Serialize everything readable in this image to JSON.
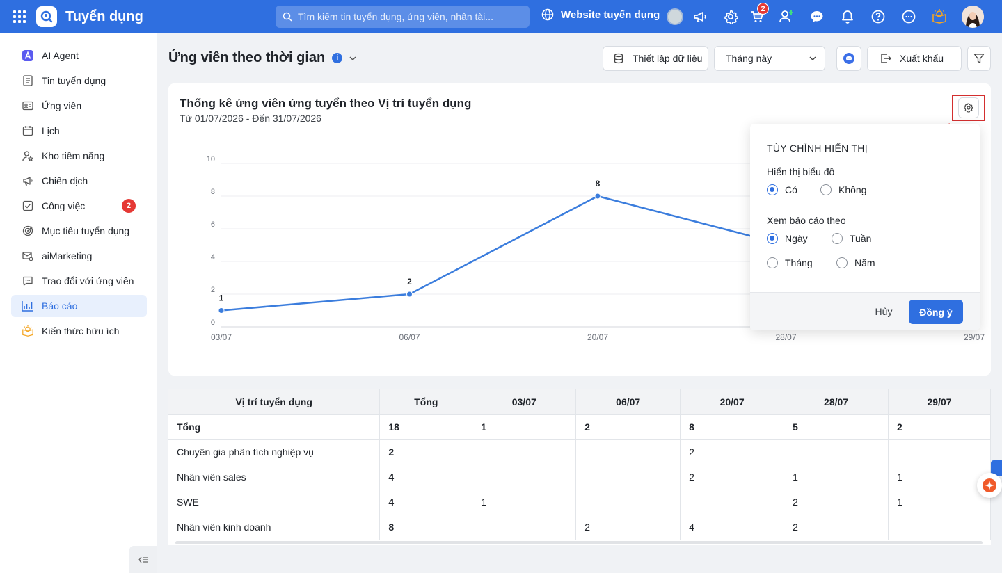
{
  "app": {
    "title": "Tuyển dụng",
    "search_placeholder": "Tìm kiếm tin tuyển dụng, ứng viên, nhân tài...",
    "website_link": "Website tuyển dụng",
    "cart_badge": "2"
  },
  "sidebar": {
    "items": [
      {
        "label": "AI Agent",
        "icon": "ai-agent-icon"
      },
      {
        "label": "Tin tuyển dụng",
        "icon": "document-icon"
      },
      {
        "label": "Ứng viên",
        "icon": "id-card-icon"
      },
      {
        "label": "Lịch",
        "icon": "calendar-icon"
      },
      {
        "label": "Kho tiềm năng",
        "icon": "star-user-icon"
      },
      {
        "label": "Chiến dịch",
        "icon": "megaphone-icon"
      },
      {
        "label": "Công việc",
        "icon": "checkbox-icon",
        "badge": "2"
      },
      {
        "label": "Mục tiêu tuyển dụng",
        "icon": "target-icon"
      },
      {
        "label": "aiMarketing",
        "icon": "mail-gear-icon"
      },
      {
        "label": "Trao đổi với ứng viên",
        "icon": "chat-icon"
      },
      {
        "label": "Báo cáo",
        "icon": "report-chart-icon",
        "active": true
      },
      {
        "label": "Kiến thức hữu ích",
        "icon": "lightbulb-icon"
      }
    ]
  },
  "header": {
    "title": "Ứng viên theo thời gian",
    "data_setup_label": "Thiết lập dữ liệu",
    "period_select": "Tháng này",
    "export_label": "Xuất khẩu"
  },
  "card": {
    "title": "Thống kê ứng viên ứng tuyển theo Vị trí tuyển dụng",
    "subtitle": "Từ 01/07/2026 - Đến 31/07/2026"
  },
  "chart_data": {
    "type": "line",
    "x": [
      "03/07",
      "06/07",
      "20/07",
      "28/07",
      "29/07"
    ],
    "series": [
      {
        "values": [
          1,
          2,
          8,
          5,
          2
        ]
      }
    ],
    "ylim": [
      0,
      10
    ],
    "yticks": [
      "0",
      "2",
      "4",
      "6",
      "8",
      "10"
    ],
    "data_labels": [
      "1",
      "2",
      "8"
    ],
    "grid": true,
    "color": "#3b7ddd"
  },
  "popup": {
    "title": "TÙY CHỈNH HIỂN THỊ",
    "show_chart_label": "Hiển thị biểu đồ",
    "show_yes": "Có",
    "show_no": "Không",
    "view_by_label": "Xem báo cáo theo",
    "opt_day": "Ngày",
    "opt_week": "Tuần",
    "opt_month": "Tháng",
    "opt_year": "Năm",
    "cancel": "Hủy",
    "ok": "Đồng ý"
  },
  "table": {
    "headers": [
      "Vị trí tuyển dụng",
      "Tổng",
      "03/07",
      "06/07",
      "20/07",
      "28/07",
      "29/07"
    ],
    "rows": [
      [
        "Tổng",
        "18",
        "1",
        "2",
        "8",
        "5",
        "2"
      ],
      [
        "Chuyên gia phân tích nghiệp vụ",
        "2",
        "",
        "",
        "2",
        "",
        ""
      ],
      [
        "Nhân viên sales",
        "4",
        "",
        "",
        "2",
        "1",
        "1"
      ],
      [
        "SWE",
        "4",
        "1",
        "",
        "",
        "2",
        "1"
      ],
      [
        "Nhân viên kinh doanh",
        "8",
        "",
        "2",
        "4",
        "2",
        ""
      ]
    ]
  }
}
